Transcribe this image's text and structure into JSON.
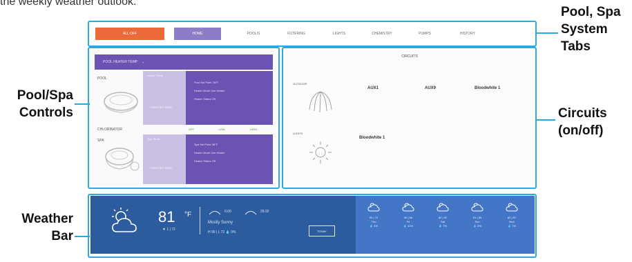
{
  "intro_text": "the weekly weather outlook.",
  "callouts": {
    "tabs_label": [
      "Pool, Spa",
      "System",
      "Tabs"
    ],
    "controls_label": [
      "Pool/Spa",
      "Controls"
    ],
    "circuits_label": [
      "Circuits",
      "(on/off)"
    ],
    "weather_label": [
      "Weather",
      "Bar"
    ]
  },
  "tabs": {
    "all_onoff": "ALL OFF",
    "home": "HOME",
    "items": [
      "POOL/S",
      "FILTERING",
      "LIGHTS",
      "CHEMISTRY",
      "PUMPS",
      "HISTORY"
    ]
  },
  "controls": {
    "header": "POOL HEATER TEMP",
    "pool": {
      "label": "POOL",
      "set_light": "Heater Temp",
      "comfort": "COMFORT TEMP",
      "rows": [
        "Pool Set Point   78°F",
        "Heater Mode   Use Heater",
        "Heater Status   Off"
      ]
    },
    "chlorinator_label": "CHLORINATOR",
    "chips": [
      "OFF",
      "LOW",
      "HIGH"
    ],
    "spa": {
      "label": "SPA",
      "set_light": "Spa Temp",
      "comfort": "COMFORT TEMP",
      "rows": [
        "Spa Set Point   98°F",
        "Heater Mode   Use Heater",
        "Heater Status   Off"
      ]
    }
  },
  "circuits": {
    "title": "CIRCUITS",
    "outdoor_label": "OUTDOOR",
    "lights_label": "LIGHTS",
    "items": [
      "AUX1",
      "AUX9",
      "Bloodwhite 1",
      "Bloodwhite 1"
    ]
  },
  "weather": {
    "temp": "81",
    "unit": "°F",
    "hi_lo": "▼ 1  |  72",
    "wind_a": "0.00",
    "wind_b": "29.92",
    "condition": "Mostly Sunny",
    "detail": "H 90  |  L 72     💧 0%",
    "today_button": "TODAY",
    "forecast": [
      {
        "temps": "90 | 72",
        "day": "Thu",
        "rain": "💧 4%"
      },
      {
        "temps": "90 | 66",
        "day": "Fri",
        "rain": "💧 41%"
      },
      {
        "temps": "82 | 62",
        "day": "Sat",
        "rain": "💧 7%"
      },
      {
        "temps": "81 | 55",
        "day": "Sun",
        "rain": "💧 0%"
      },
      {
        "temps": "82 | 67",
        "day": "Mon",
        "rain": "💧 7%"
      }
    ]
  },
  "colors": {
    "callout_line": "#29a9e0",
    "accent_orange": "#ec6a3a",
    "accent_purple": "#6a53b3",
    "weather_blue": "#2c5b9e",
    "forecast_blue": "#4376c6"
  }
}
